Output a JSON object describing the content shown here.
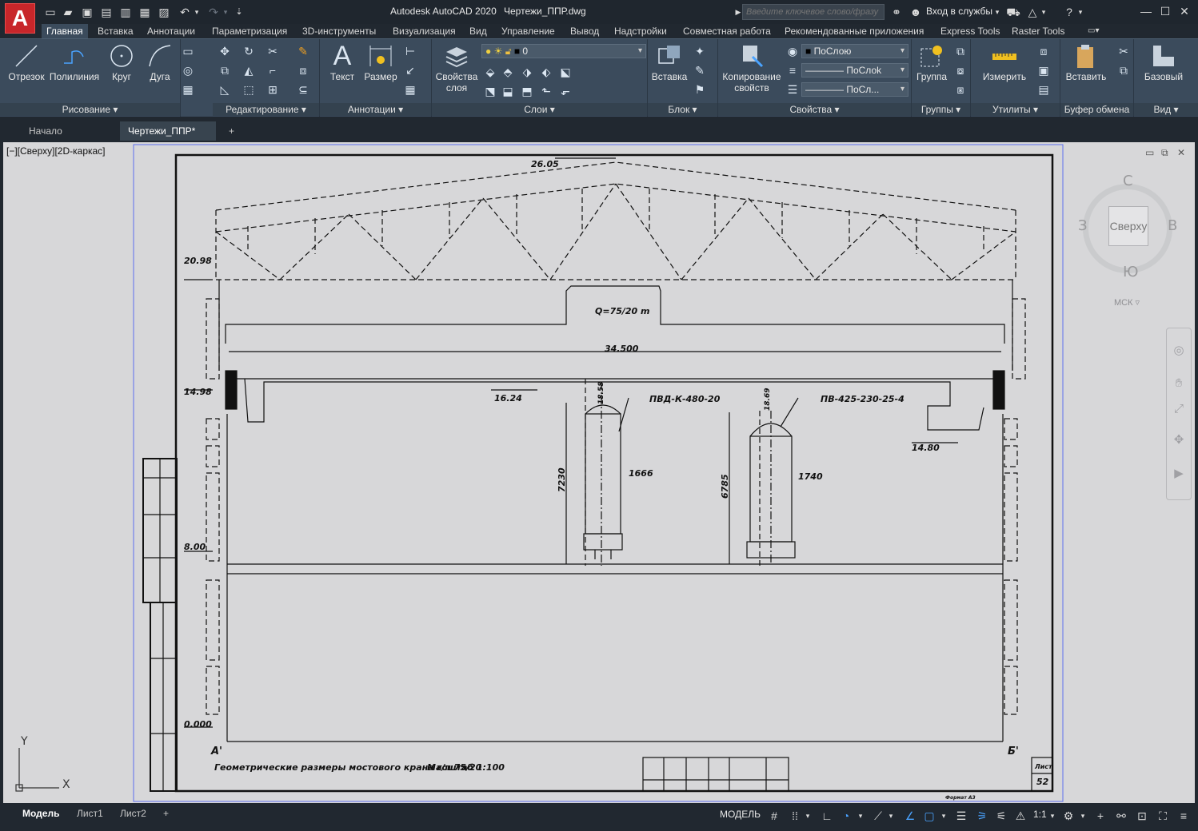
{
  "app": {
    "logo": "A",
    "title": "Autodesk AutoCAD 2020",
    "file": "Чертежи_ППР.dwg",
    "search_placeholder": "Введите ключевое слово/фразу",
    "signin": "Вход в службы"
  },
  "ribbon_tabs": [
    "Главная",
    "Вставка",
    "Аннотации",
    "Параметризация",
    "3D-инструменты",
    "Визуализация",
    "Вид",
    "Управление",
    "Вывод",
    "Надстройки",
    "Совместная работа",
    "Рекомендованные приложения",
    "Express Tools",
    "Raster Tools"
  ],
  "ribbon": {
    "draw": {
      "label": "Рисование",
      "line": "Отрезок",
      "polyline": "Полилиния",
      "circle": "Круг",
      "arc": "Дуга"
    },
    "modify": {
      "label": "Редактирование"
    },
    "annot": {
      "label": "Аннотации",
      "text": "Текст",
      "dim": "Размер"
    },
    "layers": {
      "label": "Слои",
      "props_l1": "Свойства",
      "props_l2": "слоя",
      "current_layer": "0"
    },
    "block": {
      "label": "Блок",
      "insert": "Вставка"
    },
    "props": {
      "label": "Свойства",
      "match_l1": "Копирование",
      "match_l2": "свойств",
      "color": "ПоСлою",
      "linetype": "ПоСлоk",
      "lineweight": "ПоСл..."
    },
    "groups": {
      "label": "Группы",
      "group": "Группа"
    },
    "utils": {
      "label": "Утилиты",
      "measure": "Измерить"
    },
    "clip": {
      "label": "Буфер обмена",
      "paste": "Вставить"
    },
    "view": {
      "label": "Вид",
      "base": "Базовый"
    }
  },
  "doc_tabs": {
    "start": "Начало",
    "drawing": "Чертежи_ППР*",
    "add": "+"
  },
  "viewport": {
    "label": "[−][Сверху][2D-каркас]"
  },
  "viewcube": {
    "n": "С",
    "s": "Ю",
    "w": "З",
    "e": "В",
    "face": "Сверху",
    "ucs": "МСК"
  },
  "drawing": {
    "roof_top": "26.05",
    "truss_bottom": "20.98",
    "crane": "Q=75/20 m",
    "span": "34.500",
    "rail": "14.98",
    "hook": "16.24",
    "apparatus1": "ПВД-К-480-20",
    "apparatus2": "ПВ-425-230-25-4",
    "level_right": "14.80",
    "top1": "18.58",
    "top2": "18.69",
    "h1": "7230",
    "h2": "6785",
    "d1": "1666",
    "d2": "1740",
    "floor": "8.00",
    "zero": "0.000",
    "axis_a": "А'",
    "axis_b": "Б'",
    "caption": "Геометрические размеры мостового крана г/п 75/20",
    "scale": "Масштаб 1:100",
    "sheet_label": "Лист",
    "sheet_no": "52",
    "format": "Формат А3"
  },
  "status": {
    "tabs": [
      "Модель",
      "Лист1",
      "Лист2"
    ],
    "model": "МОДЕЛЬ",
    "scale": "1:1"
  },
  "ucs_axes": {
    "x": "X",
    "y": "Y"
  }
}
